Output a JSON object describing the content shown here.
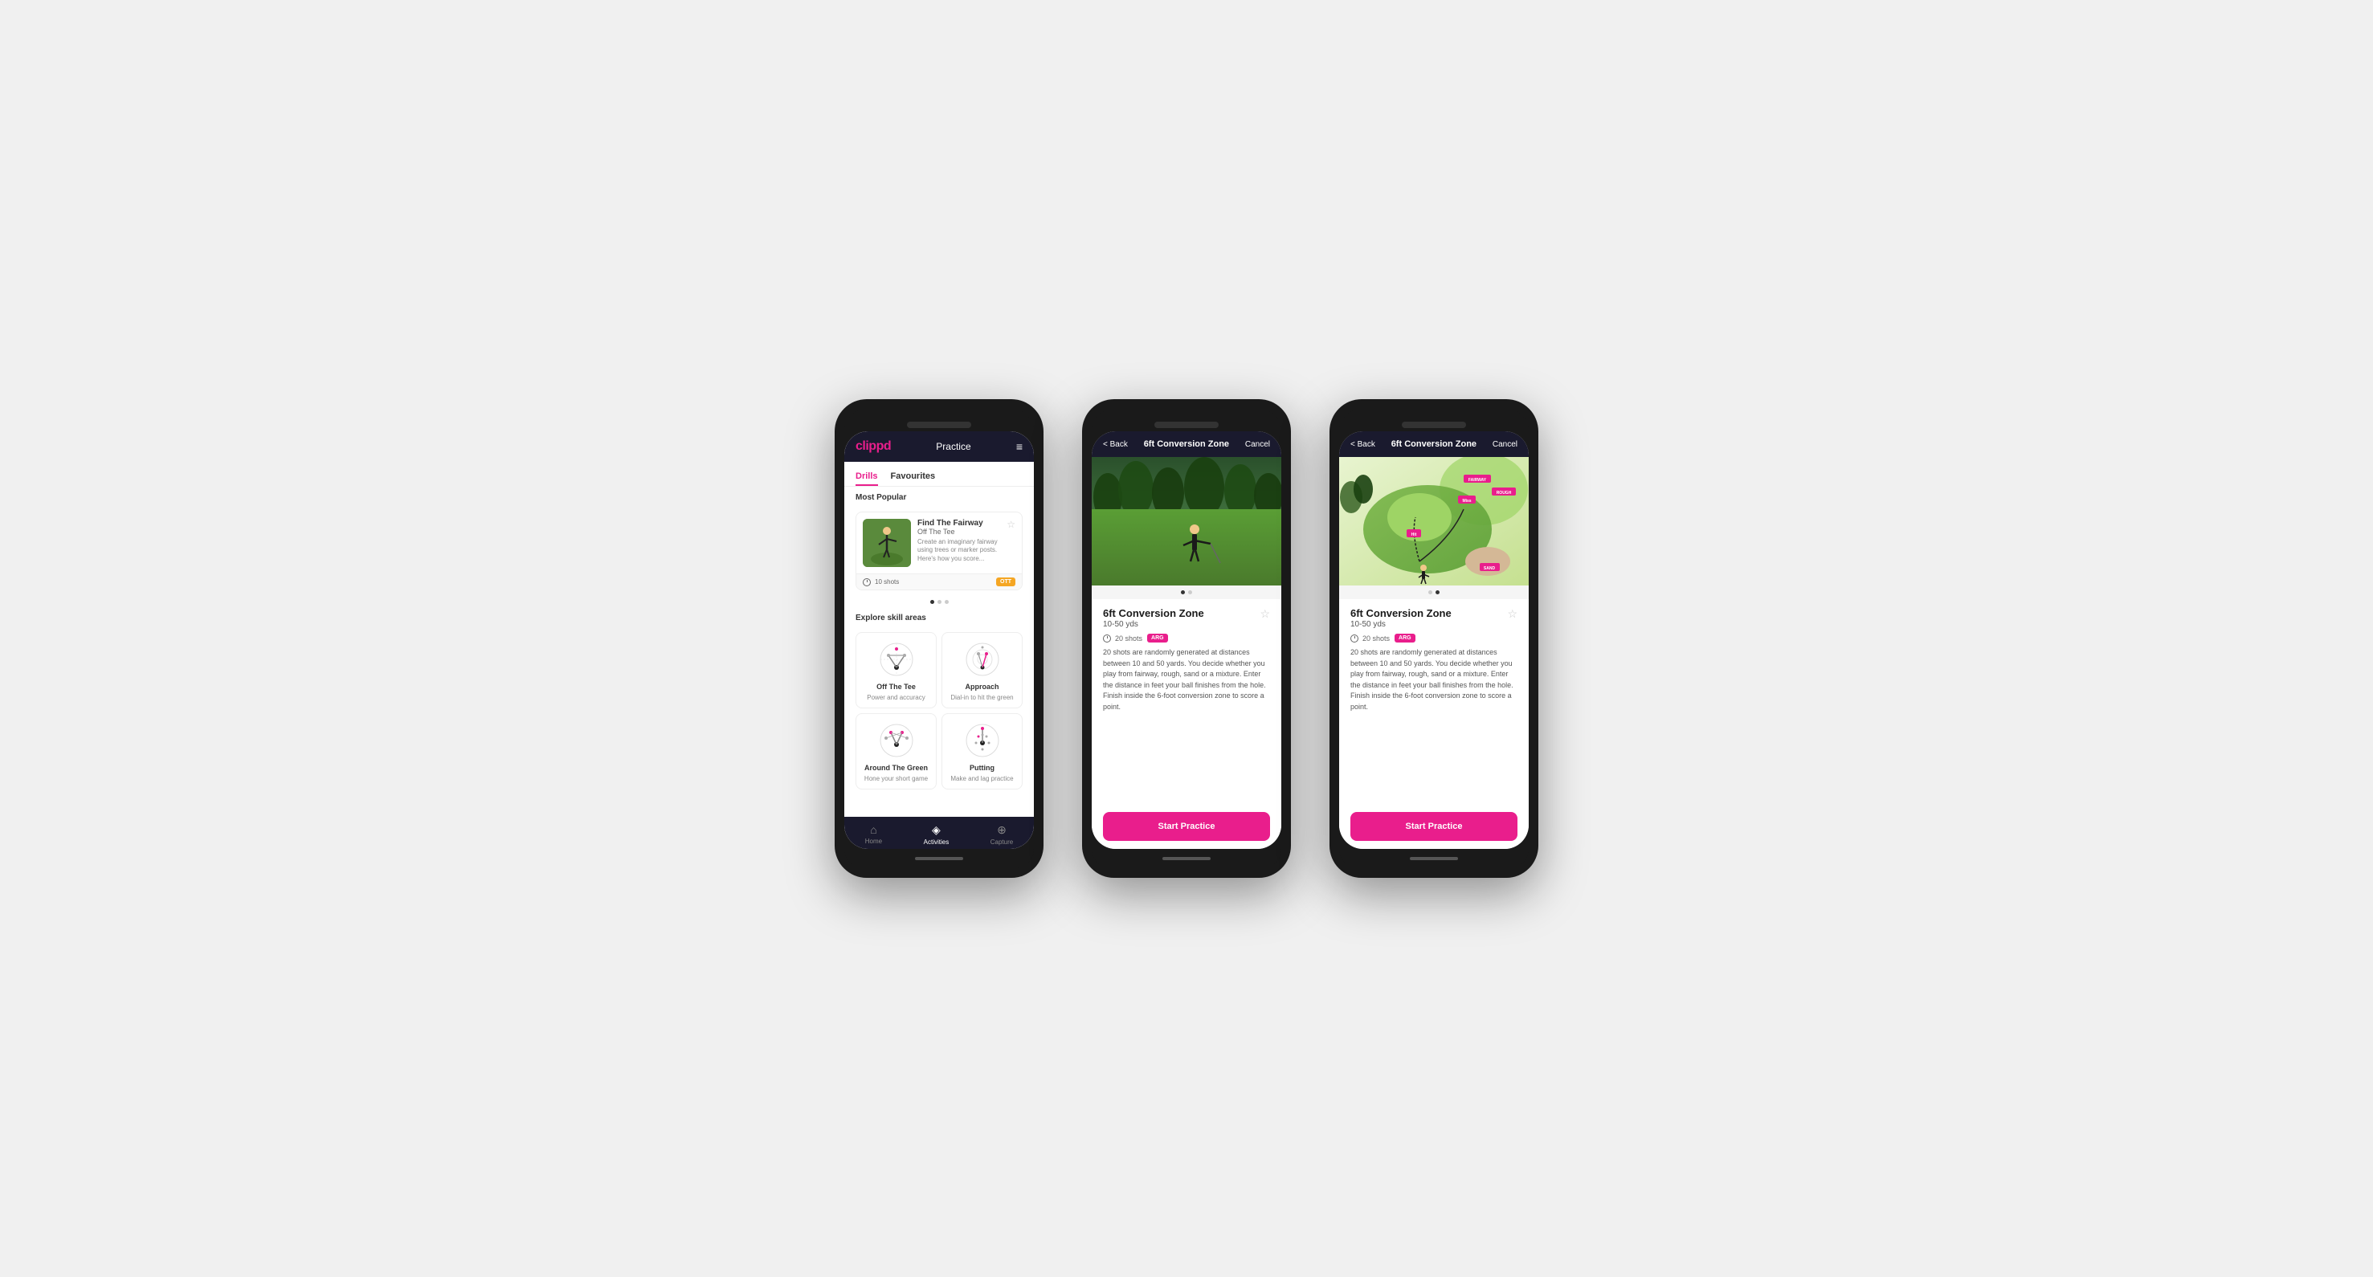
{
  "phones": [
    {
      "id": "phone1",
      "type": "list",
      "header": {
        "logo": "clippd",
        "title": "Practice",
        "menu_icon": "≡"
      },
      "tabs": [
        {
          "label": "Drills",
          "active": true
        },
        {
          "label": "Favourites",
          "active": false
        }
      ],
      "most_popular_label": "Most Popular",
      "featured_drill": {
        "name": "Find The Fairway",
        "category": "Off The Tee",
        "description": "Create an imaginary fairway using trees or marker posts. Here's how you score...",
        "shots": "10 shots",
        "badge": "OTT",
        "star_icon": "☆"
      },
      "explore_label": "Explore skill areas",
      "skills": [
        {
          "name": "Off The Tee",
          "desc": "Power and accuracy",
          "icon_type": "ott"
        },
        {
          "name": "Approach",
          "desc": "Dial-in to hit the green",
          "icon_type": "approach"
        },
        {
          "name": "Around The Green",
          "desc": "Hone your short game",
          "icon_type": "atg"
        },
        {
          "name": "Putting",
          "desc": "Make and lag practice",
          "icon_type": "putting"
        }
      ],
      "nav": [
        {
          "label": "Home",
          "icon": "⌂",
          "active": false
        },
        {
          "label": "Activities",
          "icon": "♦",
          "active": true
        },
        {
          "label": "Capture",
          "icon": "⊕",
          "active": false
        }
      ]
    },
    {
      "id": "phone2",
      "type": "detail-photo",
      "header": {
        "back": "< Back",
        "title": "6ft Conversion Zone",
        "cancel": "Cancel"
      },
      "drill": {
        "title": "6ft Conversion Zone",
        "range": "10-50 yds",
        "shots": "20 shots",
        "badge": "ARG",
        "star_icon": "☆",
        "description": "20 shots are randomly generated at distances between 10 and 50 yards. You decide whether you play from fairway, rough, sand or a mixture. Enter the distance in feet your ball finishes from the hole. Finish inside the 6-foot conversion zone to score a point."
      },
      "start_button": "Start Practice",
      "carousel_dots": [
        {
          "active": true
        },
        {
          "active": false
        }
      ]
    },
    {
      "id": "phone3",
      "type": "detail-illustration",
      "header": {
        "back": "< Back",
        "title": "6ft Conversion Zone",
        "cancel": "Cancel"
      },
      "drill": {
        "title": "6ft Conversion Zone",
        "range": "10-50 yds",
        "shots": "20 shots",
        "badge": "ARG",
        "star_icon": "☆",
        "description": "20 shots are randomly generated at distances between 10 and 50 yards. You decide whether you play from fairway, rough, sand or a mixture. Enter the distance in feet your ball finishes from the hole. Finish inside the 6-foot conversion zone to score a point."
      },
      "start_button": "Start Practice",
      "illustration_labels": {
        "miss": "Miss",
        "hit": "Hit",
        "fairway": "FAIRWAY",
        "rough": "ROUGH",
        "sand": "SAND"
      },
      "carousel_dots": [
        {
          "active": false
        },
        {
          "active": true
        }
      ]
    }
  ]
}
